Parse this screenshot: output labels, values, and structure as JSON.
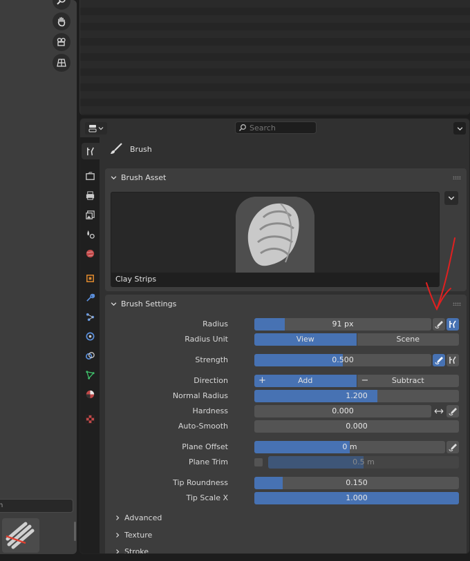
{
  "viewport": {
    "tools": [
      "zoom-icon",
      "hand-icon",
      "camera-icon",
      "grid-icon"
    ],
    "search_value": "h"
  },
  "props": {
    "search_placeholder": "Search",
    "context_title": "Brush",
    "tabs": [
      "tool",
      "render",
      "output",
      "view-layer",
      "scene",
      "world",
      "object",
      "modifiers",
      "particles",
      "physics",
      "constraints",
      "data",
      "material",
      "texture"
    ],
    "brush_asset": {
      "title": "Brush Asset",
      "name": "Clay Strips"
    },
    "brush_settings": {
      "title": "Brush Settings",
      "radius": {
        "label": "Radius",
        "value": "91 px",
        "fill": 0.17
      },
      "radius_unit": {
        "label": "Radius Unit",
        "options": [
          "View",
          "Scene"
        ],
        "selected": "View"
      },
      "strength": {
        "label": "Strength",
        "value": "0.500",
        "fill": 0.5
      },
      "direction": {
        "label": "Direction",
        "options": [
          "Add",
          "Subtract"
        ],
        "selected": "Add"
      },
      "normal_radius": {
        "label": "Normal Radius",
        "value": "1.200",
        "fill": 0.6
      },
      "hardness": {
        "label": "Hardness",
        "value": "0.000",
        "fill": 0
      },
      "auto_smooth": {
        "label": "Auto-Smooth",
        "value": "0.000",
        "fill": 0
      },
      "plane_offset": {
        "label": "Plane Offset",
        "value": "0 m",
        "fill": 0.5
      },
      "plane_trim": {
        "label": "Plane Trim",
        "value": "0.5 m"
      },
      "tip_roundness": {
        "label": "Tip Roundness",
        "value": "0.150",
        "fill": 0.15
      },
      "tip_scale_x": {
        "label": "Tip Scale X",
        "value": "1.000",
        "fill": 1.0
      }
    },
    "subpanels": [
      "Advanced",
      "Texture",
      "Stroke"
    ]
  },
  "colors": {
    "accent": "#4772b3",
    "annotation": "#e02020"
  }
}
